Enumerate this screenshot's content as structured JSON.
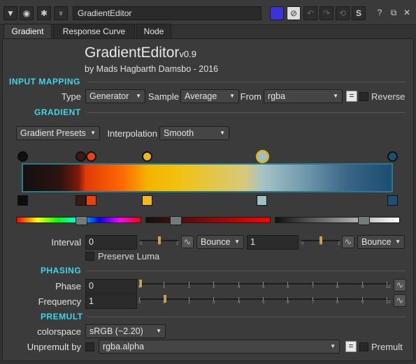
{
  "titlebar": {
    "node_name": "GradientEditor",
    "icons": [
      "collapse-icon",
      "viewer-icon",
      "bug-icon",
      "tools-icon"
    ],
    "right_icons": [
      "color-swatch-icon",
      "no-color-icon",
      "undo-icon",
      "redo-icon",
      "revert-icon",
      "script-icon",
      "help-icon",
      "float-icon",
      "close-icon"
    ],
    "s_label": "S",
    "help_label": "?",
    "close_label": "✕"
  },
  "tabs": [
    "Gradient",
    "Response Curve",
    "Node"
  ],
  "header": {
    "title": "GradientEditor",
    "version": "v0.9",
    "author": "by Mads Hagbarth Damsbo - 2016"
  },
  "input_mapping": {
    "section": "INPUT MAPPING",
    "type_label": "Type",
    "type_value": "Generator",
    "sample_label": "Sample",
    "sample_value": "Average",
    "from_label": "From",
    "from_value": "rgba",
    "eq_label": "=",
    "reverse_label": "Reverse"
  },
  "gradient": {
    "section": "GRADIENT",
    "presets_label": "Gradient Presets",
    "interp_label": "Interpolation",
    "interp_value": "Smooth",
    "stop_colors": [
      "#101010",
      "#3a1b14",
      "#e8410a",
      "#f2b81a",
      "#9fbfc7",
      "#1d4f72"
    ]
  },
  "interval": {
    "label": "Interval",
    "value1": "0",
    "mode1": "Bounce",
    "value2": "1",
    "mode2": "Bounce",
    "mini_ticks": [
      "0",
      "1",
      "2"
    ],
    "preserve_luma": "Preserve Luma"
  },
  "phasing": {
    "section": "PHASING",
    "phase_label": "Phase",
    "phase_value": "0",
    "freq_label": "Frequency",
    "freq_value": "1",
    "ticks": [
      "0",
      "1",
      "2",
      "3",
      "4",
      "5",
      "6",
      "7",
      "8",
      "9",
      "10"
    ]
  },
  "premult": {
    "section": "PREMULT",
    "colorspace_label": "colorspace",
    "colorspace_value": "sRGB (~2.20)",
    "unpremult_label": "Unpremult by",
    "unpremult_value": "rgba.alpha",
    "eq_label": "=",
    "premult_label": "Premult"
  },
  "colors": {
    "accent": "#3fd7e8",
    "panel": "#3b3b3b",
    "gradient_border": "#2a7a8a"
  }
}
